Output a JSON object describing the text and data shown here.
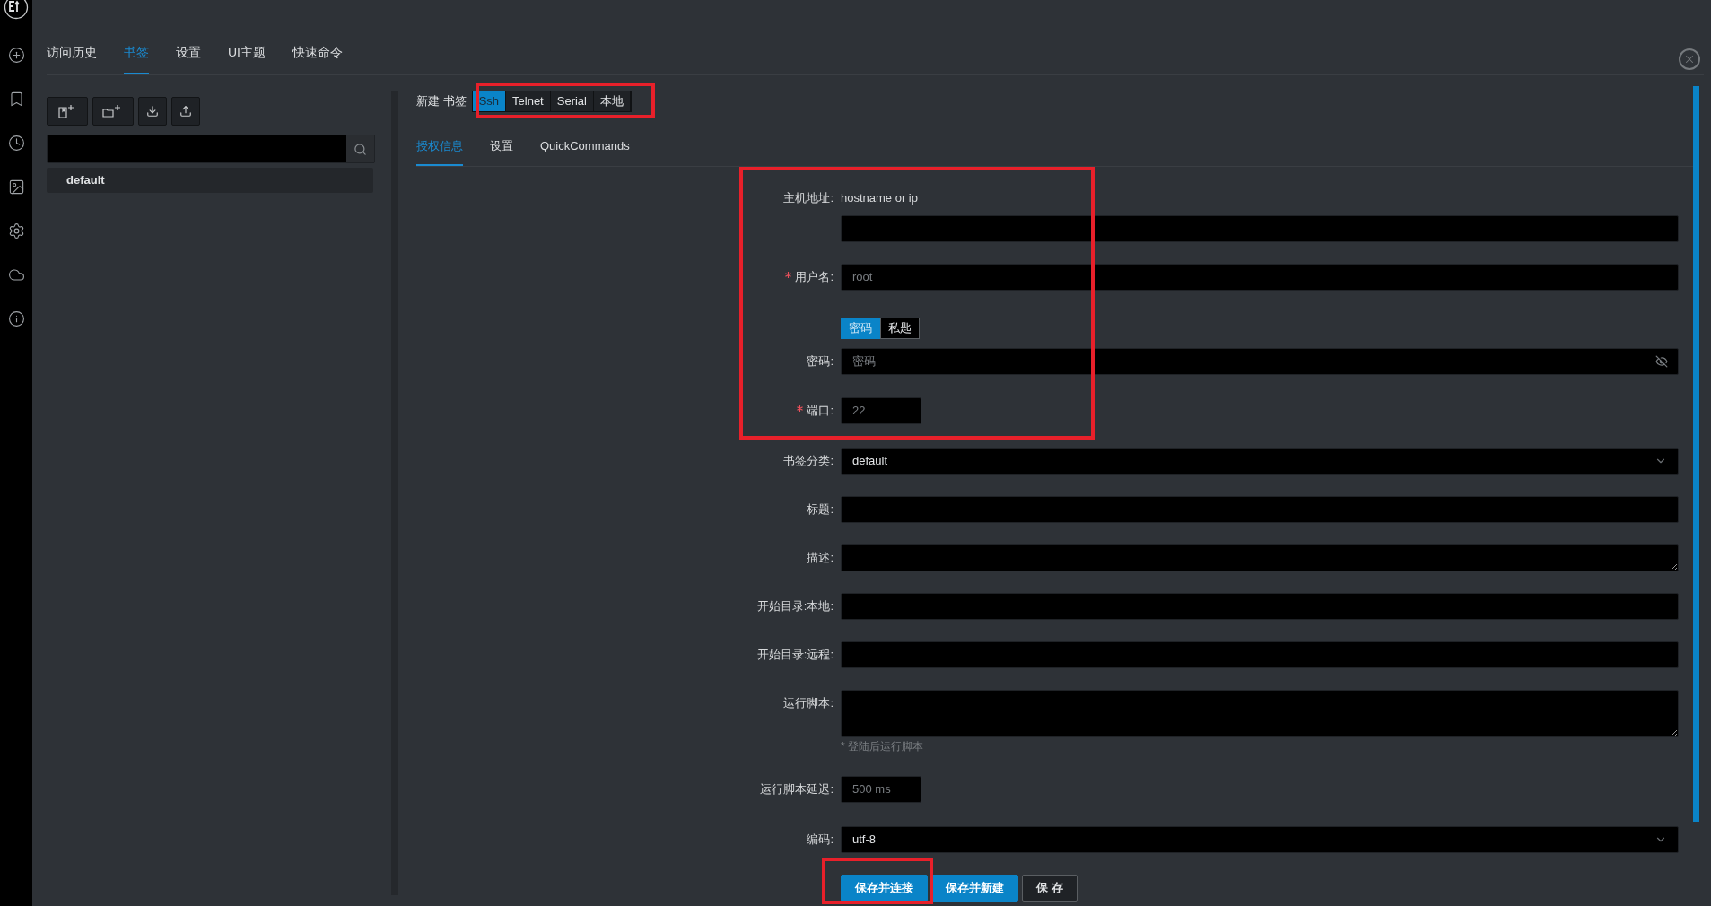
{
  "nav_tabs": [
    {
      "label": "访问历史",
      "selected": false
    },
    {
      "label": "书签",
      "selected": true
    },
    {
      "label": "设置",
      "selected": false
    },
    {
      "label": "UI主题",
      "selected": false
    },
    {
      "label": "快速命令",
      "selected": false
    }
  ],
  "bookmark_tree": [
    {
      "label": "default",
      "selected": true
    }
  ],
  "form_header": {
    "title": "新建 书签",
    "types": [
      {
        "label": "Ssh",
        "selected": true
      },
      {
        "label": "Telnet",
        "selected": false
      },
      {
        "label": "Serial",
        "selected": false
      },
      {
        "label": "本地",
        "selected": false
      }
    ]
  },
  "sub_tabs": [
    {
      "label": "授权信息",
      "selected": true
    },
    {
      "label": "设置",
      "selected": false
    },
    {
      "label": "QuickCommands",
      "selected": false
    }
  ],
  "fields": [
    {
      "kind": "stacked",
      "label": "主机地址:",
      "required": false,
      "note": "hostname or ip"
    },
    {
      "kind": "text",
      "label": "用户名:",
      "required": true,
      "placeholder": "root"
    },
    {
      "kind": "segmented",
      "options": [
        {
          "label": "密码",
          "selected": true
        },
        {
          "label": "私匙",
          "selected": false
        }
      ]
    },
    {
      "kind": "password",
      "label": "密码:",
      "required": false,
      "placeholder": "密码"
    },
    {
      "kind": "short",
      "label": "端口:",
      "required": true,
      "placeholder": "22"
    },
    {
      "kind": "select",
      "label": "书签分类:",
      "required": false,
      "value": "default"
    },
    {
      "kind": "text",
      "label": "标题:",
      "required": false
    },
    {
      "kind": "textarea",
      "label": "描述:",
      "required": false
    },
    {
      "kind": "text",
      "label": "开始目录:本地:",
      "required": false
    },
    {
      "kind": "text",
      "label": "开始目录:远程:",
      "required": false
    },
    {
      "kind": "tallarea",
      "label": "运行脚本:",
      "required": false,
      "hint": "* 登陆后运行脚本"
    },
    {
      "kind": "short",
      "label": "运行脚本延迟:",
      "required": false,
      "placeholder": "500 ms"
    },
    {
      "kind": "select",
      "label": "编码:",
      "required": false,
      "value": "utf-8"
    }
  ],
  "buttons": [
    {
      "label": "保存并连接",
      "kind": "primary"
    },
    {
      "label": "保存并新建",
      "kind": "primary"
    },
    {
      "label": "保 存",
      "kind": "default"
    }
  ]
}
